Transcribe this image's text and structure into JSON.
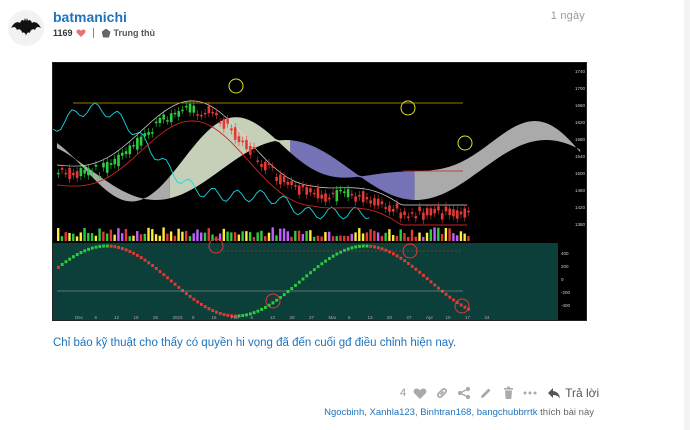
{
  "post": {
    "author": "batmanichi",
    "timestamp": "1 ngày",
    "like_total": "1169",
    "user_level": "Trung thủ",
    "body": "Chỉ báo kỹ thuật cho thấy có quyền hi vọng đã đến cuối gđ điều chỉnh hiện nay.",
    "like_count": "4",
    "reply_label": "Trả lời",
    "likers": [
      "Ngocbinh",
      "Xanhla123",
      "Binhtran168",
      "bangchubbrrtk"
    ],
    "likers_suffix": "thích bài này",
    "likers_sep": ", "
  },
  "chart_image": {
    "price_axis": [
      "1740",
      "1700",
      "1660",
      "1620",
      "1580",
      "1540",
      "1500",
      "1460",
      "1420",
      "1380"
    ],
    "date_axis": [
      "Dec",
      "5",
      "12",
      "19",
      "26",
      "2023",
      "9",
      "16",
      "Feb",
      "6",
      "13",
      "20",
      "27",
      "Mar",
      "6",
      "13",
      "20",
      "27",
      "Apr",
      "10",
      "17",
      "24"
    ],
    "osc_axis": [
      "400",
      "200",
      "0",
      "-200",
      "-400"
    ],
    "colors": {
      "background": "#000000",
      "oscillator_bg": "#0c3f3a",
      "bull_candle": "#2ecc40",
      "bear_candle": "#e53935",
      "cloud_bear": "#c8c8c8",
      "cloud_bull": "#8a87d6",
      "lagging": "#17d6e0",
      "markers": "#e0e020"
    }
  }
}
